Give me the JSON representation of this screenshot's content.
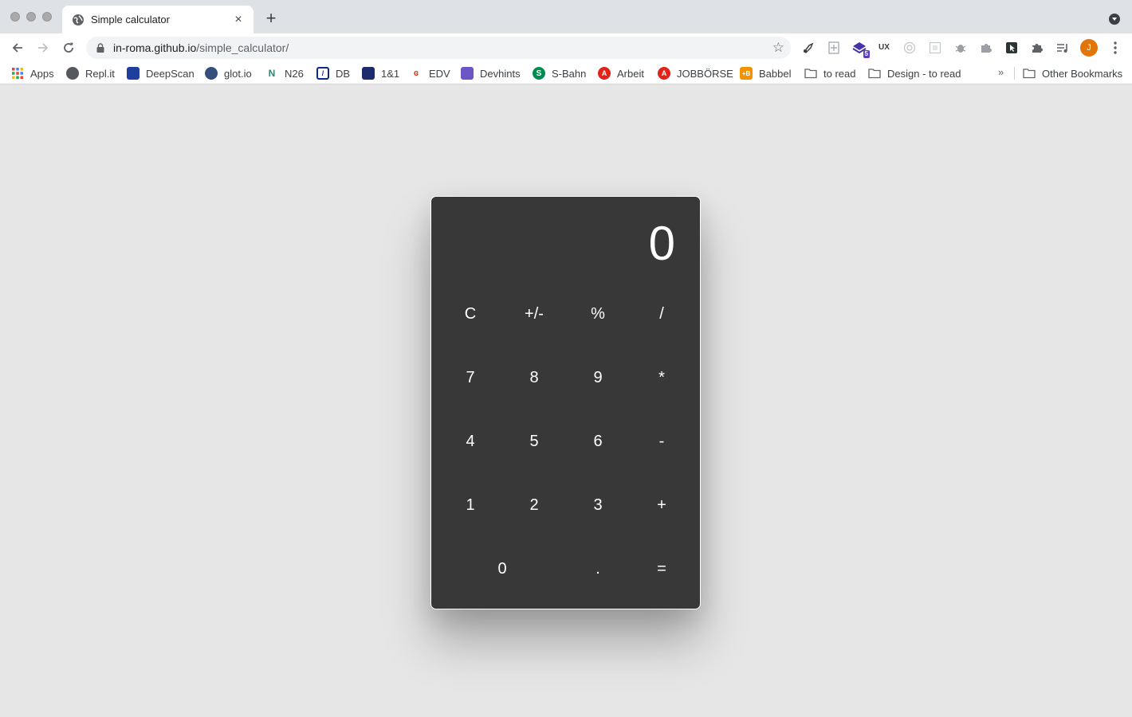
{
  "browser": {
    "tab_title": "Simple calculator",
    "tab_close": "×",
    "new_tab": "+",
    "url_host": "in-roma.github.io",
    "url_path": "/simple_calculator/",
    "profile_initial": "J",
    "extension_badge": "5",
    "extension_ux_label": "UX"
  },
  "bookmarks": {
    "items": [
      {
        "label": "Apps",
        "icon": "apps-grid-icon"
      },
      {
        "label": "Repl.it",
        "icon": "replit-icon"
      },
      {
        "label": "DeepScan",
        "icon": "deepscan-icon"
      },
      {
        "label": "glot.io",
        "icon": "glot-icon"
      },
      {
        "label": "N26",
        "icon": "n26-icon"
      },
      {
        "label": "DB",
        "icon": "db-icon"
      },
      {
        "label": "1&1",
        "icon": "1und1-icon"
      },
      {
        "label": "EDV",
        "icon": "edv-icon"
      },
      {
        "label": "Devhints",
        "icon": "devhints-icon"
      },
      {
        "label": "S-Bahn",
        "icon": "sbahn-icon"
      },
      {
        "label": "Arbeit",
        "icon": "arbeit-icon"
      },
      {
        "label": "JOBBÖRSE",
        "icon": "jobboerse-icon"
      },
      {
        "label": "Babbel",
        "icon": "babbel-icon"
      },
      {
        "label": "to read",
        "icon": "folder-icon"
      },
      {
        "label": "Design - to read",
        "icon": "folder-icon"
      }
    ],
    "overflow": "»",
    "other": "Other Bookmarks"
  },
  "calculator": {
    "display": "0",
    "keys": {
      "clear": "C",
      "sign": "+/-",
      "percent": "%",
      "divide": "/",
      "seven": "7",
      "eight": "8",
      "nine": "9",
      "multiply": "*",
      "four": "4",
      "five": "5",
      "six": "6",
      "minus": "-",
      "one": "1",
      "two": "2",
      "three": "3",
      "plus": "+",
      "zero": "0",
      "decimal": ".",
      "equals": "="
    }
  },
  "colors": {
    "calculator_bg": "#383838",
    "page_bg": "#e6e6e6",
    "profile": "#e3740a"
  }
}
